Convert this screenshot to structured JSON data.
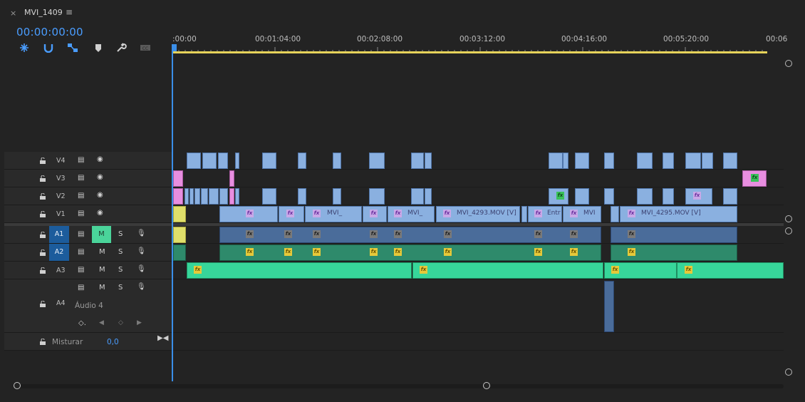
{
  "sequence": {
    "title": "MVI_1409",
    "timecode": "00:00:00:00"
  },
  "ruler": {
    "labels": [
      ":00:00",
      "00:01:04:00",
      "00:02:08:00",
      "00:03:12:00",
      "00:04:16:00",
      "00:05:20:00",
      "00:06"
    ]
  },
  "tracks": {
    "v4": {
      "name": "V4"
    },
    "v3": {
      "name": "V3"
    },
    "v2": {
      "name": "V2"
    },
    "v1": {
      "name": "V1"
    },
    "a1": {
      "name": "A1",
      "target": "A1",
      "mute": "M",
      "solo": "S"
    },
    "a2": {
      "name": "A2",
      "target": "A2",
      "mute": "M",
      "solo": "S"
    },
    "a3": {
      "name": "A3",
      "mute": "M",
      "solo": "S"
    },
    "a4": {
      "name": "A4",
      "label": "Áudio 4",
      "mute": "M",
      "solo": "S"
    },
    "mix": {
      "name": "Misturar",
      "value": "0,0"
    }
  },
  "clips": {
    "v1_labels": [
      "MVI_",
      "MVI_",
      "MVI_4293.MOV [V]",
      "Entr",
      "MVI",
      "MVI_4295.MOV [V]"
    ]
  },
  "colors": {
    "accent": "#4a9dff",
    "video_clip": "#8ab0e0",
    "pink_clip": "#e88ee0",
    "audio_clip": "#2e8a6b",
    "workarea": "#e7d35a"
  }
}
